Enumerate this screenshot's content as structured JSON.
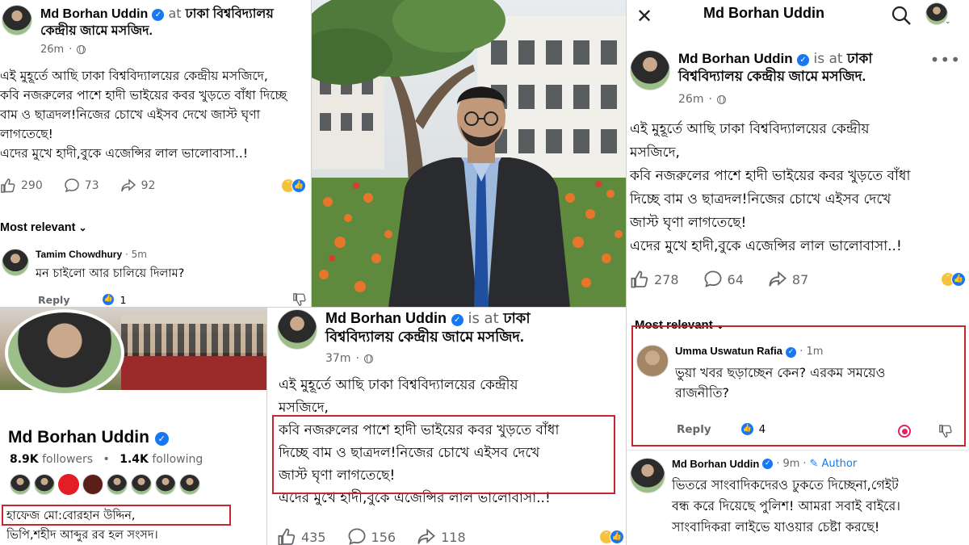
{
  "post": {
    "author": "Md Borhan Uddin",
    "is_at": "is at",
    "is_at_short": "at",
    "location": "ঢাকা বিশ্ববিদ্যালয় কেন্দ্রীয় জামে মসজিদ.",
    "location_line1": "ঢাকা বিশ্ববিদ্যালয়",
    "location_line2": "কেন্দ্রীয় জামে মসজিদ.",
    "loc_p3_line1": "ঢাকা",
    "loc_p3_line2": "বিশ্ববিদ্যালয় কেন্দ্রীয় জামে মসজিদ.",
    "loc_p5_line1": "ঢাকা",
    "loc_p5_line2": "বিশ্ববিদ্যালয় কেন্দ্রীয় জামে মসজিদ.",
    "time_26": "26m",
    "time_37": "37m"
  },
  "panel1": {
    "lines": [
      "এই মুহূর্তে আছি ঢাকা বিশ্ববিদ্যালয়ের কেন্দ্রীয় মসজিদে,",
      "কবি নজরুলের পাশে হাদী ভাইয়ের কবর খুড়তে বাঁধা দিচ্ছে",
      "বাম ও ছাত্রদল!নিজের চোখে এইসব দেখে জাস্ট ঘৃণা",
      "লাগতেছে!",
      "এদের মুখে হাদী,বুকে এজেন্সির লাল ভালোবাসা..!"
    ],
    "likes": "290",
    "comments": "73",
    "shares": "92",
    "sort_label": "Most relevant",
    "comment": {
      "author": "Tamim Chowdhury",
      "time": "5m",
      "text": "মন চাইলো আর চালিয়ে দিলাম?",
      "reply": "Reply",
      "like_count": "1"
    }
  },
  "panel3": {
    "header_title": "Md Borhan Uddin",
    "lines": [
      "এই মুহূর্তে আছি ঢাকা বিশ্ববিদ্যালয়ের কেন্দ্রীয়",
      "মসজিদে,",
      "কবি নজরুলের পাশে হাদী ভাইয়ের কবর খুড়তে বাঁধা",
      "দিচ্ছে বাম ও ছাত্রদল!নিজের চোখে এইসব দেখে",
      "জাস্ট ঘৃণা লাগতেছে!",
      "এদের মুখে হাদী,বুকে এজেন্সির লাল ভালোবাসা..!"
    ],
    "likes": "278",
    "comments": "64",
    "shares": "87"
  },
  "panel4": {
    "name": "Md Borhan Uddin",
    "followers_count": "8.9K",
    "followers_label": "followers",
    "following_count": "1.4K",
    "following_label": "following",
    "bio_line1": "হাফেজ মো:বোরহান উদ্দিন,",
    "bio_line2": "ভিপি,শহীদ আব্দুর রব হল সংসদ।"
  },
  "panel5": {
    "lines": [
      "এই মুহূর্তে আছি ঢাকা বিশ্ববিদ্যালয়ের কেন্দ্রীয়",
      "মসজিদে,",
      "কবি নজরুলের পাশে হাদী ভাইয়ের কবর খুড়তে বাঁধা",
      "দিচ্ছে বাম ও ছাত্রদল!নিজের চোখে এইসব দেখে",
      "জাস্ট ঘৃণা লাগতেছে!",
      "এদের মুখে হাদী,বুকে এজেন্সির লাল ভালোবাসা..!"
    ],
    "likes": "435",
    "comments": "156",
    "shares": "118"
  },
  "panel6": {
    "sort_label": "Most relevant",
    "comment1": {
      "author": "Umma Uswatun Rafia",
      "time": "1m",
      "text_line1": "ভুয়া খবর ছড়াচ্ছেন কেন? এরকম সময়েও",
      "text_line2": "রাজনীতি?",
      "reply": "Reply",
      "like_count": "4"
    },
    "comment2": {
      "author": "Md Borhan Uddin",
      "time": "9m",
      "badge": "Author",
      "text_line1": "ভিতরে সাংবাদিকদেরও ঢুকতে দিচ্ছেনা,গেইট",
      "text_line2": "বন্ধ করে দিয়েছে পুলিশ! আমরা সবাই বাইরে।",
      "text_line3": "সাংবাদিকরা লাইভে যাওয়ার চেষ্টা করছে!"
    }
  },
  "colors": {
    "accent": "#1877f2",
    "highlight": "#c8262f",
    "muted": "#65676b"
  }
}
